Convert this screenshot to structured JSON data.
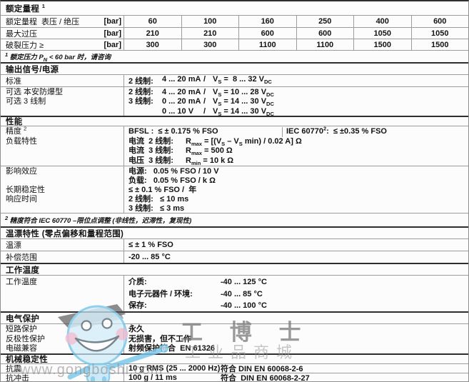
{
  "table": {
    "s1": {
      "header_tokens": [
        {
          "t": "额定量程 "
        },
        {
          "sup": "1"
        }
      ],
      "row1": {
        "label": "额定量程",
        "label2": "表压 / 绝压",
        "unit": "[bar]",
        "values": [
          "60",
          "100",
          "160",
          "250",
          "400",
          "600"
        ]
      },
      "row2": {
        "label": "最大过压",
        "unit": "[bar]",
        "values": [
          "210",
          "210",
          "600",
          "600",
          "1050",
          "1050"
        ]
      },
      "row3": {
        "label": "破裂压力 ≥",
        "unit": "[bar]",
        "values": [
          "300",
          "300",
          "1100",
          "1100",
          "1500",
          "1500"
        ]
      },
      "footnote_tokens": [
        {
          "sup": "1"
        },
        {
          "t": " 额定压力 P"
        },
        {
          "sub": "N"
        },
        {
          "t": " < 60 bar 时，请咨询"
        }
      ]
    },
    "s2": {
      "header": "输出信号/电源",
      "standard": {
        "label": "标准",
        "line": {
          "c1": "2 线制:",
          "c2": "4 ... 20 mA",
          "c3": "/",
          "tokens": [
            {
              "t": "V"
            },
            {
              "sub": "S"
            },
            {
              "t": " =  8 ... 32 V"
            },
            {
              "sub": "DC"
            }
          ]
        }
      },
      "optional": {
        "labels": [
          "可选 本安防爆型",
          "可选 3 线制"
        ],
        "lines": [
          {
            "c1": "2 线制:",
            "c2": "4 ... 20 mA",
            "c3": "/",
            "tokens": [
              {
                "t": "V"
              },
              {
                "sub": "S"
              },
              {
                "t": " = 10 ... 28 V"
              },
              {
                "sub": "DC"
              }
            ]
          },
          {
            "c1": "3 线制:",
            "c2": "0 ... 20 mA",
            "c3": "/",
            "tokens": [
              {
                "t": "V"
              },
              {
                "sub": "S"
              },
              {
                "t": " = 14 ... 30 V"
              },
              {
                "sub": "DC"
              }
            ]
          },
          {
            "c1": "",
            "c2": "0 ... 10 V",
            "c3": "/",
            "tokens": [
              {
                "t": "V"
              },
              {
                "sub": "S"
              },
              {
                "t": " = 14 ... 30 V"
              },
              {
                "sub": "DC"
              }
            ]
          }
        ]
      }
    },
    "s3": {
      "header": "性能",
      "accuracy": {
        "label_tokens": [
          {
            "t": "精度 "
          },
          {
            "sup": "2"
          }
        ],
        "label2": "负载特性",
        "bfsl": "BFSL :  ≤ ± 0.175 % FSO",
        "iec_tokens": [
          {
            "t": "IEC 60770"
          },
          {
            "sup": "2"
          },
          {
            "t": ":  ≤ ±0.35 % FSO"
          }
        ],
        "lines": [
          {
            "c1": "电流  2 线制:",
            "tokens": [
              {
                "t": "R"
              },
              {
                "sub": "max"
              },
              {
                "t": " = [(V"
              },
              {
                "sub": "S"
              },
              {
                "t": " – V"
              },
              {
                "sub": "S"
              },
              {
                "t": " min) / 0.02 A] Ω"
              }
            ]
          },
          {
            "c1": "电流  3 线制:",
            "tokens": [
              {
                "t": "R"
              },
              {
                "sub": "max"
              },
              {
                "t": " = 500 Ω"
              }
            ]
          },
          {
            "c1": "电压  3 线制:",
            "tokens": [
              {
                "t": "R"
              },
              {
                "sub": "min"
              },
              {
                "t": " = 10 k Ω"
              }
            ]
          }
        ]
      },
      "influence": {
        "labels": [
          "影响效应",
          "长期稳定性",
          "响应时间"
        ],
        "lines": [
          "电源:   0.05 % FSO / 10 V",
          "负载:   0.05 % FSO / k Ω",
          "≤ ± 0.1 % FSO /  年",
          "2 线制:   ≤ 10 ms",
          "3 线制:   ≤ 3 ms"
        ]
      },
      "footnote_tokens": [
        {
          "sup": "2"
        },
        {
          "t": " 精度符合 IEC 60770 –限位点调整 (非线性，迟滞性，复现性)"
        }
      ]
    },
    "s4": {
      "header": "温漂特性 (零点偏移和量程范围)",
      "rows": [
        {
          "label": "温漂",
          "value": "≤ ± 1 % FSO"
        },
        {
          "label": "补偿范围",
          "value": "-20 ... 85 °C"
        }
      ]
    },
    "s5": {
      "header": "工作温度",
      "label": "工作温度",
      "lines": [
        {
          "name": "介质:",
          "value": "-40 ... 125 °C"
        },
        {
          "name": "电子元器件 / 环境:",
          "value": "-40 ... 85 °C"
        },
        {
          "name": "保存:",
          "value": "-40 ... 100 °C"
        }
      ]
    },
    "s6": {
      "header": "电气保护",
      "lines": [
        {
          "label": "短路保护",
          "value": "永久"
        },
        {
          "label": "反极性保护",
          "value": "无损害，但不工作"
        },
        {
          "label": "电磁兼容",
          "value": "射频保护符合  EN 61326"
        }
      ]
    },
    "s7": {
      "header": "机械稳定性",
      "rows": [
        {
          "label": "抗震",
          "value1": "10 g RMS (25 ... 2000 Hz)",
          "value2": "符合 DIN EN 60068-2-6"
        },
        {
          "label": "抗冲击",
          "value1": "100 g / 11 ms",
          "value2": "符合  DIN EN 60068-2-27"
        }
      ]
    }
  },
  "watermark": {
    "brand": "工 博 士",
    "tagline": "工业品商城",
    "url": "www.gongboshi.com",
    "colors": {
      "mascot_blue": "#aadcf4",
      "mascot_outline": "#79c7ea",
      "cap_gray": "#4d4d4d",
      "text_gray": "#9b9b9b"
    }
  }
}
